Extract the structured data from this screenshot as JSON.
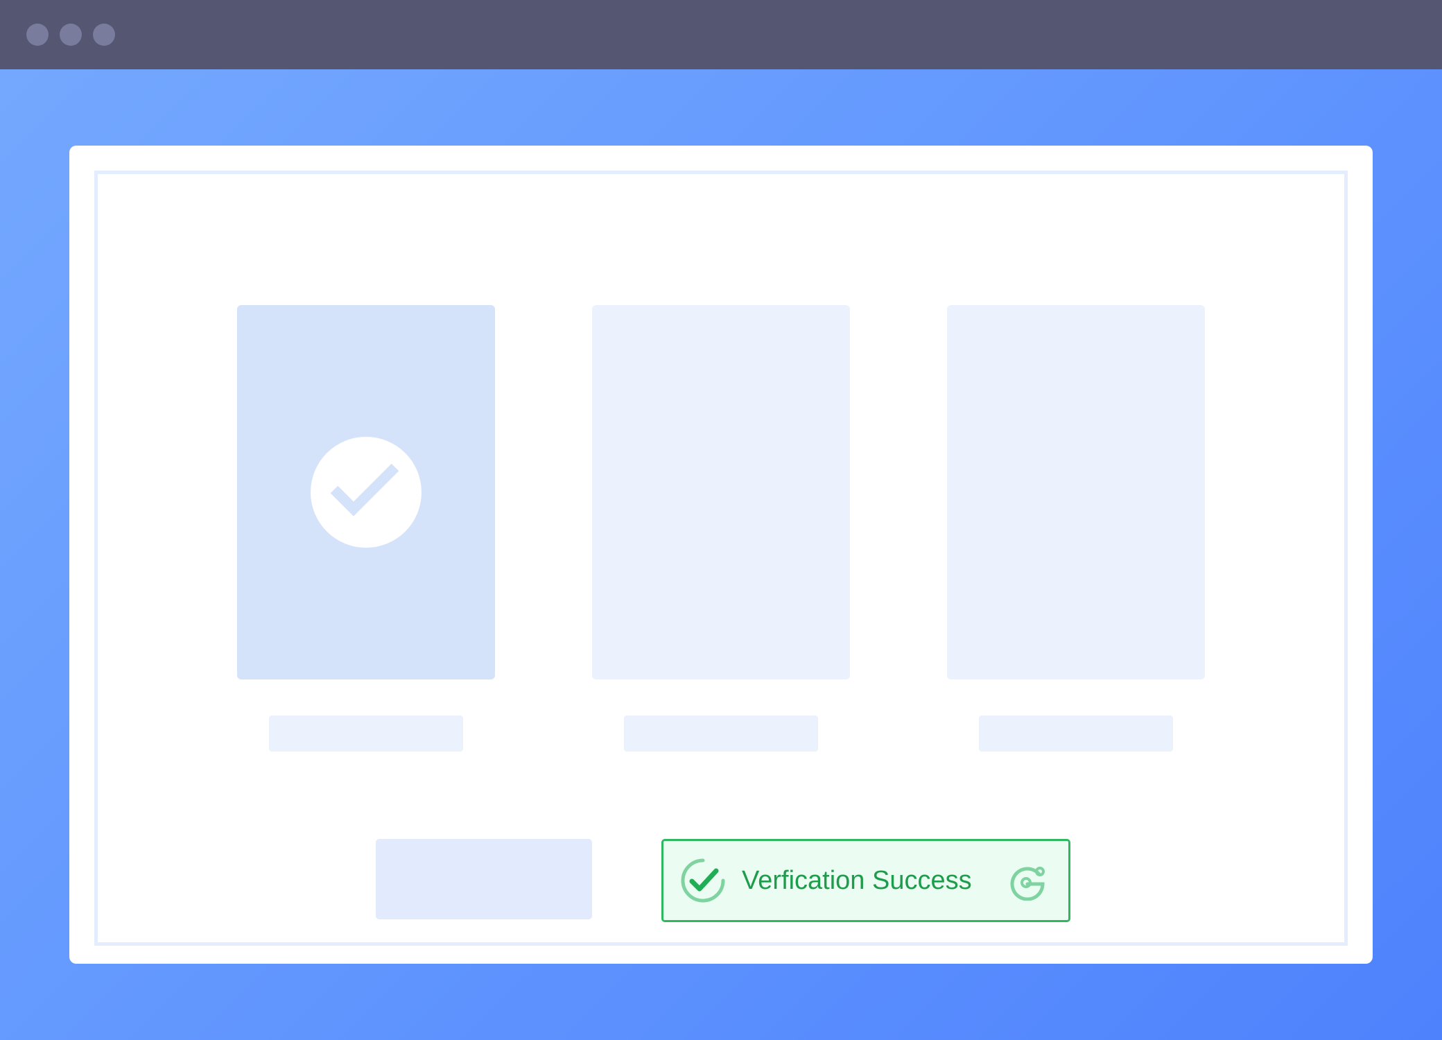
{
  "window": {
    "controls": [
      "window-dot",
      "window-dot",
      "window-dot"
    ]
  },
  "captcha": {
    "cards": [
      {
        "selected": true,
        "icon": "check-icon"
      },
      {
        "selected": false
      },
      {
        "selected": false
      }
    ]
  },
  "verification": {
    "status_label": "Verfication Success",
    "status_icon": "circle-check-icon",
    "brand_icon": "captcha-logo-icon",
    "colors": {
      "success_text": "#1d9c4c",
      "success_border": "#2fb760",
      "success_bg": "#ebfdf2"
    }
  },
  "colors": {
    "titlebar": "#545672",
    "background_start": "#74a8fe",
    "background_end": "#4e82fd",
    "card_selected": "#d5e3fa",
    "card": "#ebf2fe"
  }
}
